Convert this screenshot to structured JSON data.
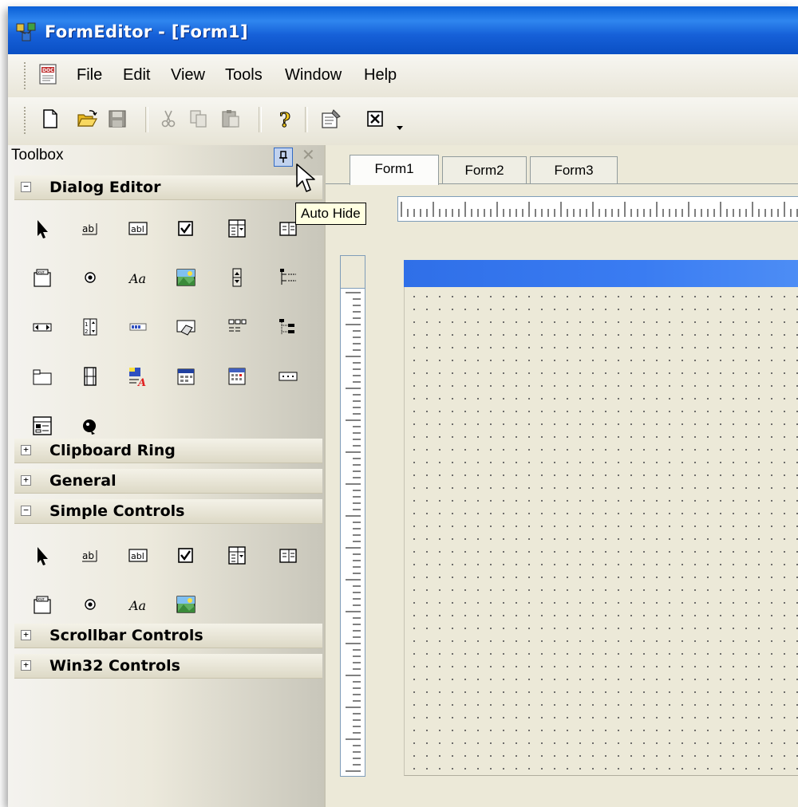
{
  "window": {
    "title": "FormEditor - [Form1]",
    "accent": "#0a5fd6"
  },
  "menu": {
    "items": [
      "File",
      "Edit",
      "View",
      "Tools",
      "Window",
      "Help"
    ],
    "doc_icon": "doc-icon"
  },
  "toolbar": {
    "icons": [
      "new-document-icon",
      "open-folder-icon",
      "save-icon",
      "cut-icon",
      "copy-icon",
      "paste-icon",
      "help-icon",
      "properties-icon",
      "close-box-icon",
      "overflow-chevron-icon"
    ]
  },
  "toolbox": {
    "title": "Toolbox",
    "categories": [
      {
        "label": "Dialog Editor",
        "expanded": true
      },
      {
        "label": "Clipboard Ring",
        "expanded": false
      },
      {
        "label": "General",
        "expanded": false
      },
      {
        "label": "Simple Controls",
        "expanded": true
      },
      {
        "label": "Scrollbar Controls",
        "expanded": false
      },
      {
        "label": "Win32 Controls",
        "expanded": false
      }
    ]
  },
  "tooltip": {
    "text": "Auto Hide"
  },
  "tabs": [
    "Form1",
    "Form2",
    "Form3"
  ],
  "active_tab": "Form1"
}
